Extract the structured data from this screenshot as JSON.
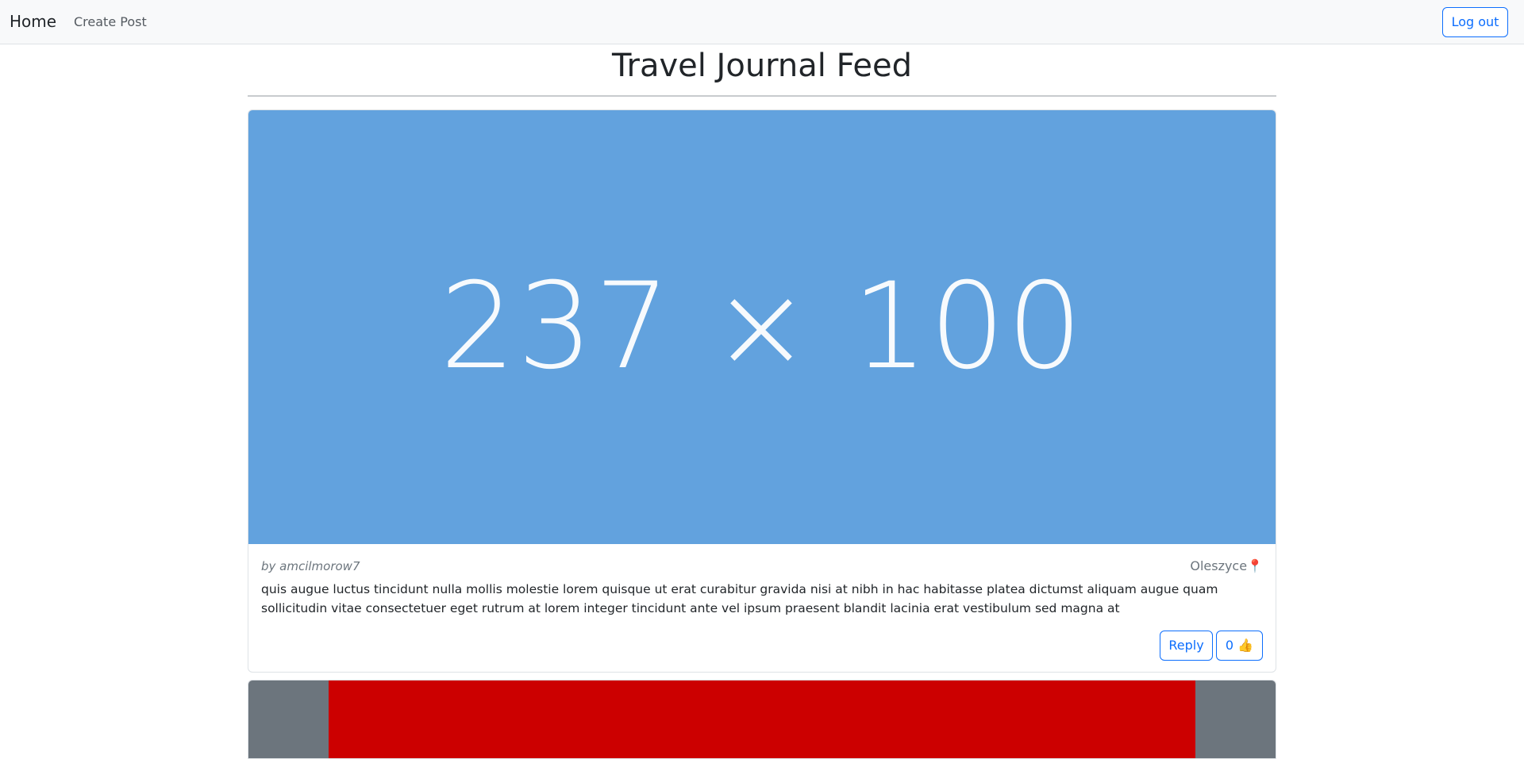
{
  "nav": {
    "brand": "Home",
    "create_post": "Create Post",
    "logout": "Log out"
  },
  "page": {
    "title": "Travel Journal Feed"
  },
  "posts": [
    {
      "image_text": "237 × 100",
      "image_color": "#62a2de",
      "author": "by amcilmorow7",
      "location": "Oleszyce📍",
      "body": "quis augue luctus tincidunt nulla mollis molestie lorem quisque ut erat curabitur gravida nisi at nibh in hac habitasse platea dictumst aliquam augue quam sollicitudin vitae consectetuer eget rutrum at lorem integer tincidunt ante vel ipsum praesent blandit lacinia erat vestibulum sed magna at",
      "reply_label": "Reply",
      "like_label": "0 👍"
    },
    {
      "image_colors": [
        "#6c757d",
        "#cc0000"
      ]
    }
  ],
  "colors": {
    "accent": "#0d6efd",
    "navbar_bg": "#f8f9fa",
    "muted": "#6c757d"
  }
}
